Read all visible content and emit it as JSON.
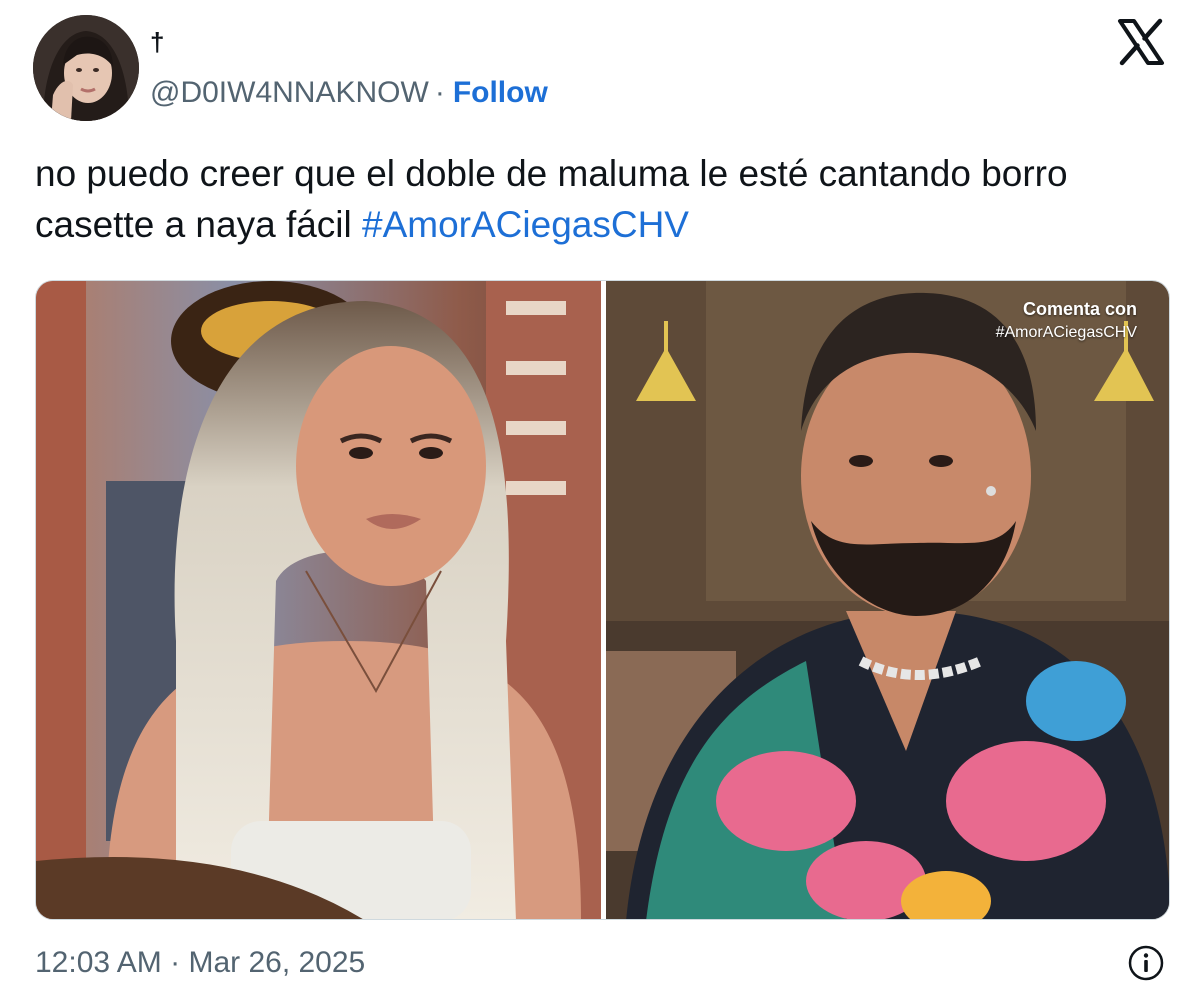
{
  "author": {
    "display_name": "†",
    "handle": "@D0IW4NNAKNOW",
    "separator": "·",
    "follow_label": "Follow"
  },
  "brand_icon": "x-logo-icon",
  "tweet": {
    "text": "no puedo creer que el doble de maluma le esté cantando borro casette a naya fácil ",
    "hashtag": "#AmorACiegasCHV"
  },
  "media": {
    "overlay_line1": "Comenta con",
    "overlay_line2": "#AmorACiegasCHV"
  },
  "footer": {
    "time": "12:03 AM",
    "separator": "·",
    "date": "Mar 26, 2025",
    "info_icon": "info-icon"
  },
  "colors": {
    "link": "#1d6fd6",
    "secondary_text": "#536471",
    "primary_text": "#0f1419"
  }
}
